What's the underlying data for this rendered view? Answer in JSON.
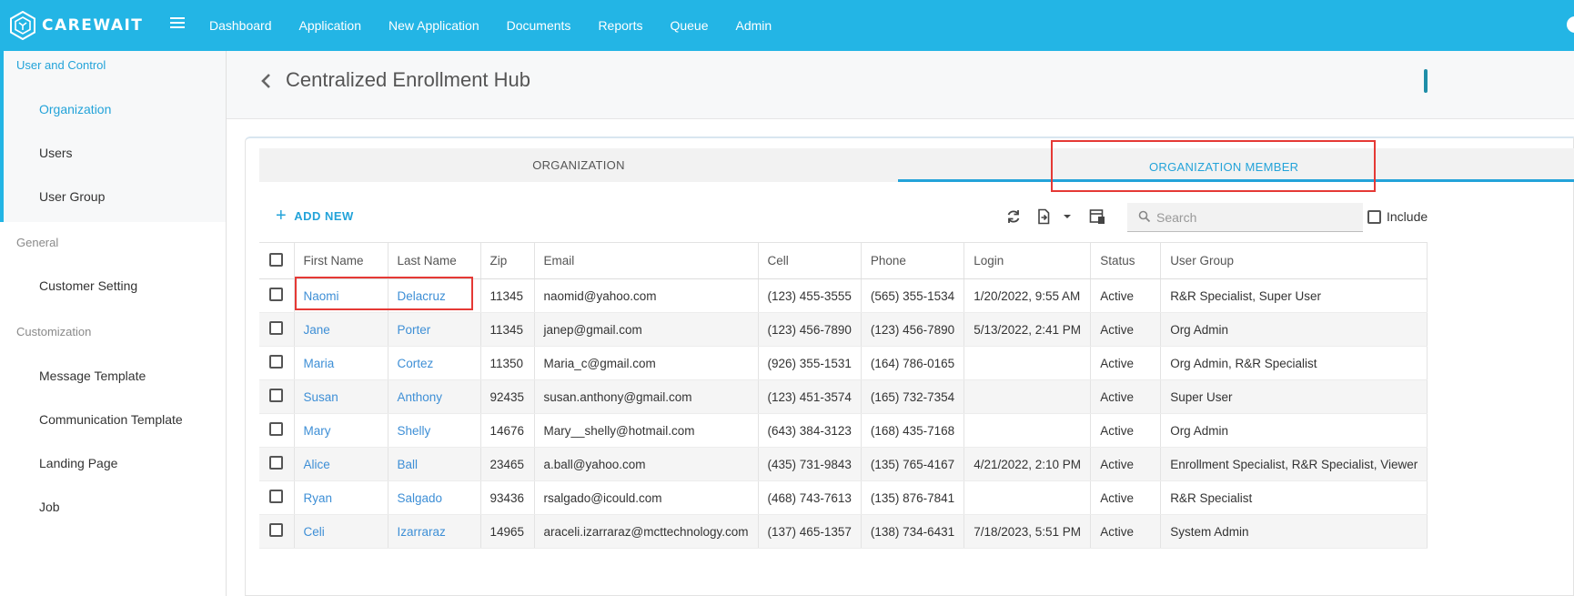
{
  "brand": {
    "name": "CAREWAIT"
  },
  "topnav": [
    "Dashboard",
    "Application",
    "New Application",
    "Documents",
    "Reports",
    "Queue",
    "Admin"
  ],
  "sidebar": {
    "sections": [
      {
        "heading": "User and Control",
        "items": [
          "Organization",
          "Users",
          "User Group"
        ]
      },
      {
        "heading": "General",
        "items": [
          "Customer Setting"
        ]
      },
      {
        "heading": "Customization",
        "items": [
          "Message Template",
          "Communication Template",
          "Landing Page",
          "Job"
        ]
      }
    ]
  },
  "page": {
    "title": "Centralized Enrollment Hub"
  },
  "tabs": {
    "organization": "ORGANIZATION",
    "member": "ORGANIZATION MEMBER",
    "active": "member"
  },
  "toolbar": {
    "add_new": "ADD NEW",
    "search_placeholder": "Search",
    "include_label": "Include"
  },
  "colors": {
    "brand": "#23b5e5",
    "accent": "#23a3d9",
    "link": "#3e8fd6",
    "highlight": "#e53935"
  },
  "table": {
    "columns": [
      "First Name",
      "Last Name",
      "Zip",
      "Email",
      "Cell",
      "Phone",
      "Login",
      "Status",
      "User Group"
    ],
    "rows": [
      [
        "Naomi",
        "Delacruz",
        "11345",
        "naomid@yahoo.com",
        "(123) 455-3555",
        "(565) 355-1534",
        "1/20/2022, 9:55 AM",
        "Active",
        "R&R Specialist, Super User"
      ],
      [
        "Jane",
        "Porter",
        "11345",
        "janep@gmail.com",
        "(123) 456-7890",
        "(123) 456-7890",
        "5/13/2022, 2:41 PM",
        "Active",
        "Org Admin"
      ],
      [
        "Maria",
        "Cortez",
        "11350",
        "Maria_c@gmail.com",
        "(926) 355-1531",
        "(164) 786-0165",
        "",
        "Active",
        "Org Admin, R&R Specialist"
      ],
      [
        "Susan",
        "Anthony",
        "92435",
        "susan.anthony@gmail.com",
        "(123) 451-3574",
        "(165) 732-7354",
        "",
        "Active",
        "Super User"
      ],
      [
        "Mary",
        "Shelly",
        "14676",
        "Mary__shelly@hotmail.com",
        "(643) 384-3123",
        "(168) 435-7168",
        "",
        "Active",
        "Org Admin"
      ],
      [
        "Alice",
        "Ball",
        "23465",
        "a.ball@yahoo.com",
        "(435) 731-9843",
        "(135) 765-4167",
        "4/21/2022, 2:10 PM",
        "Active",
        "Enrollment Specialist, R&R Specialist, Viewer"
      ],
      [
        "Ryan",
        "Salgado",
        "93436",
        "rsalgado@icould.com",
        "(468) 743-7613",
        "(135) 876-7841",
        "",
        "Active",
        "R&R Specialist"
      ],
      [
        "Celi",
        "Izarraraz",
        "14965",
        "araceli.izarraraz@mcttechnology.com",
        "(137) 465-1357",
        "(138) 734-6431",
        "7/18/2023, 5:51 PM",
        "Active",
        "System Admin"
      ]
    ]
  }
}
